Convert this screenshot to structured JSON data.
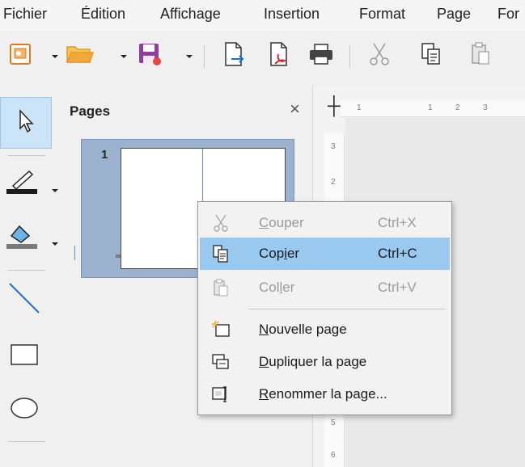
{
  "menubar": {
    "items": [
      "Fichier",
      "Édition",
      "Affichage",
      "Insertion",
      "Format",
      "Page",
      "For"
    ]
  },
  "toolbar": {
    "buttons": [
      "template-icon",
      "open-folder-icon",
      "save-icon",
      "export-icon",
      "export-pdf-icon",
      "print-icon",
      "cut-icon",
      "copy-icon",
      "paste-icon"
    ]
  },
  "draw_toolbar": {
    "tools": [
      "select-arrow-icon",
      "line-color-icon",
      "fill-color-icon",
      "line-tool-icon",
      "rectangle-tool-icon",
      "ellipse-tool-icon"
    ]
  },
  "pages_panel": {
    "title": "Pages",
    "close_label": "×",
    "pages": [
      {
        "number": "1"
      }
    ]
  },
  "rulers": {
    "horizontal": [
      "1",
      "1",
      "2",
      "3"
    ],
    "vertical": [
      "3",
      "2",
      "5",
      "6"
    ]
  },
  "context_menu": {
    "items": [
      {
        "label": "Couper",
        "mnemonic_index": 0,
        "shortcut": "Ctrl+X",
        "enabled": false,
        "highlighted": false,
        "icon": "cut-icon"
      },
      {
        "label": "Copier",
        "mnemonic_index": 3,
        "shortcut": "Ctrl+C",
        "enabled": true,
        "highlighted": true,
        "icon": "copy-icon"
      },
      {
        "label": "Coller",
        "mnemonic_index": 3,
        "shortcut": "Ctrl+V",
        "enabled": false,
        "highlighted": false,
        "icon": "paste-icon"
      },
      {
        "label": "Nouvelle page",
        "mnemonic_index": 0,
        "shortcut": "",
        "enabled": true,
        "highlighted": false,
        "icon": "new-page-icon"
      },
      {
        "label": "Dupliquer la page",
        "mnemonic_index": 0,
        "shortcut": "",
        "enabled": true,
        "highlighted": false,
        "icon": "duplicate-page-icon"
      },
      {
        "label": "Renommer la page...",
        "mnemonic_index": 0,
        "shortcut": "",
        "enabled": true,
        "highlighted": false,
        "icon": "rename-page-icon"
      }
    ]
  },
  "colors": {
    "highlight": "#99c9ef",
    "page_selection": "#9bb2cf",
    "disabled_text": "#9a9a9a",
    "save_icon": "#8f3f9e",
    "folder_icon": "#f2a93b"
  }
}
